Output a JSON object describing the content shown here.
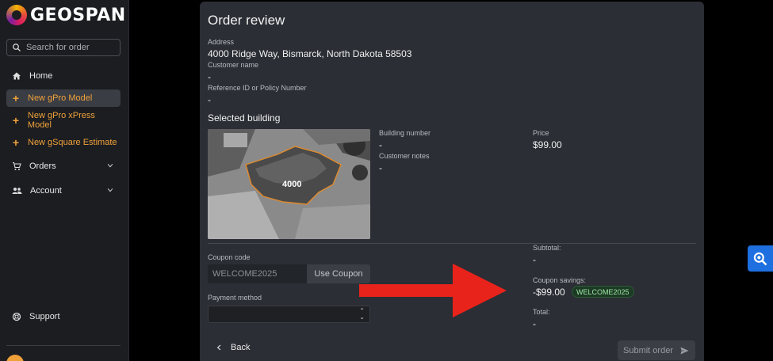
{
  "app": {
    "logo_text": "GEOSPAN"
  },
  "sidebar": {
    "search_placeholder": "Search for order",
    "items": [
      {
        "label": "Home",
        "icon": "home-icon"
      },
      {
        "label": "New gPro Model",
        "icon": "plus-icon"
      },
      {
        "label": "New gPro xPress Model",
        "icon": "plus-icon"
      },
      {
        "label": "New gSquare Estimate",
        "icon": "plus-icon"
      },
      {
        "label": "Orders",
        "icon": "cart-icon"
      },
      {
        "label": "Account",
        "icon": "people-icon"
      },
      {
        "label": "Support",
        "icon": "lifebuoy-icon"
      }
    ]
  },
  "order": {
    "title": "Order review",
    "address_label": "Address",
    "address": "4000 Ridge Way, Bismarck, North Dakota 58503",
    "customer_name_label": "Customer name",
    "customer_name": "-",
    "reference_label": "Reference ID or Policy Number",
    "reference": "-",
    "selected_building_label": "Selected building",
    "building_marker": "4000",
    "building_number_label": "Building number",
    "building_number": "-",
    "customer_notes_label": "Customer notes",
    "customer_notes": "-",
    "price_label": "Price",
    "price": "$99.00"
  },
  "payment": {
    "coupon_label": "Coupon code",
    "coupon_value": "WELCOME2025",
    "use_coupon_label": "Use Coupon",
    "payment_method_label": "Payment method",
    "payment_method_value": ""
  },
  "summary": {
    "subtotal_label": "Subtotal:",
    "subtotal": "-",
    "coupon_savings_label": "Coupon savings:",
    "coupon_savings": "-$99.00",
    "coupon_badge": "WELCOME2025",
    "total_label": "Total:",
    "total": "-"
  },
  "actions": {
    "back_label": "Back",
    "submit_label": "Submit order"
  },
  "colors": {
    "accent_orange": "#f0a13a",
    "panel_bg": "#2b2e34",
    "annotation_arrow": "#e8231b",
    "float_button": "#1e6fe0"
  }
}
